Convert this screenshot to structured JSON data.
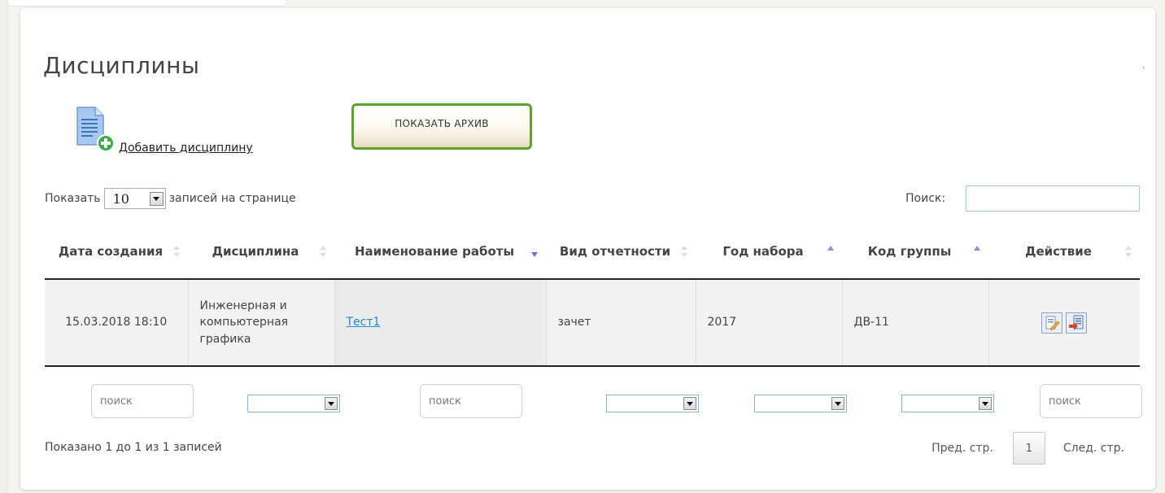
{
  "page": {
    "title": "Дисциплины",
    "corner_mark": "."
  },
  "toolbar": {
    "add_label": "Добавить дисциплину",
    "archive_label": "ПОКАЗАТЬ АРХИВ"
  },
  "length": {
    "prefix": "Показать",
    "value": "10",
    "suffix": "записей на странице"
  },
  "search": {
    "label": "Поиск:",
    "value": ""
  },
  "table": {
    "columns": [
      {
        "label": "Дата создания",
        "sort": "both"
      },
      {
        "label": "Дисциплина",
        "sort": "both"
      },
      {
        "label": "Наименование работы",
        "sort": "desc"
      },
      {
        "label": "Вид отчетности",
        "sort": "both"
      },
      {
        "label": "Год набора",
        "sort": "asc"
      },
      {
        "label": "Код группы",
        "sort": "asc"
      },
      {
        "label": "Действие",
        "sort": "both"
      }
    ],
    "rows": [
      {
        "date": "15.03.2018 18:10",
        "discipline": "Инженерная и компьютерная графика",
        "work": "Тест1",
        "report": "зачет",
        "year": "2017",
        "group": "ДВ-11",
        "actions": [
          "edit-icon",
          "delete-icon"
        ]
      }
    ]
  },
  "filters": {
    "text_placeholder": "поиск"
  },
  "footer": {
    "info": "Показано 1 до 1 из 1 записей",
    "prev": "Пред. стр.",
    "page": "1",
    "next": "След. стр."
  },
  "colors": {
    "accent_border": "#5aa62a",
    "link": "#1a8dd0",
    "sort_active": "#6d71cf"
  }
}
